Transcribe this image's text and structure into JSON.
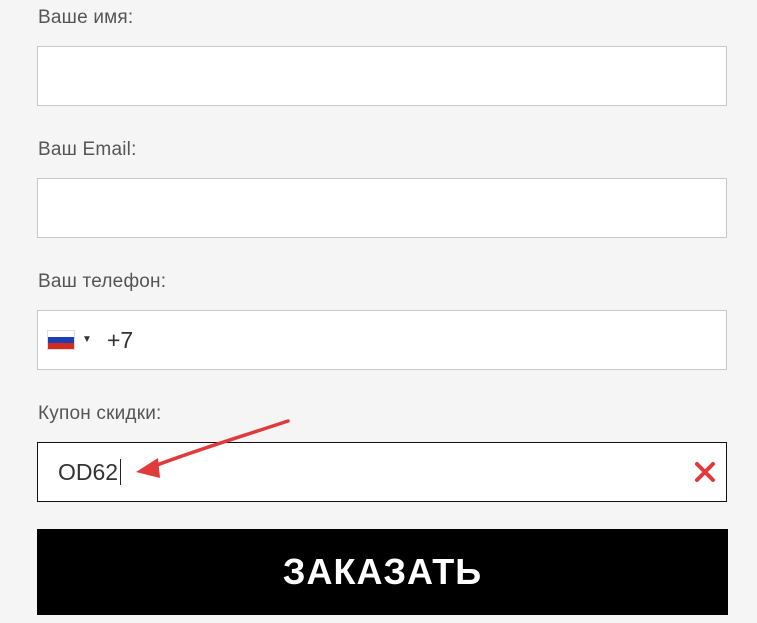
{
  "form": {
    "name_label": "Ваше имя:",
    "name_value": "",
    "email_label": "Ваш Email:",
    "email_value": "",
    "phone_label": "Ваш телефон:",
    "phone_country_flag": "russia-flag-icon",
    "phone_code": "+7",
    "coupon_label": "Купон скидки:",
    "coupon_value": "OD62",
    "coupon_status_icon": "close-icon",
    "submit_label": "ЗАКАЗАТЬ"
  },
  "colors": {
    "background": "#f5f5f5",
    "label": "#555555",
    "border": "#c8c8c8",
    "active_border": "#111111",
    "error_icon": "#e03a3a",
    "button_bg": "#000000",
    "button_text": "#ffffff",
    "annotation_arrow": "#e03a3a"
  }
}
